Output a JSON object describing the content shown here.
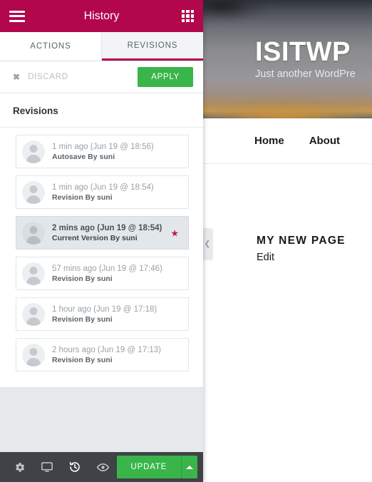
{
  "panel": {
    "title": "History",
    "menu_icon": "hamburger-icon",
    "grid_icon": "grid-apps-icon",
    "tabs": [
      {
        "label": "ACTIONS",
        "active": false
      },
      {
        "label": "REVISIONS",
        "active": true
      }
    ],
    "actions_bar": {
      "discard_label": "DISCARD",
      "discard_icon": "close-x-icon",
      "apply_label": "APPLY",
      "apply_color": "#39b54a"
    },
    "section_title": "Revisions",
    "revisions": [
      {
        "when": "1 min ago (Jun 19 @ 18:56)",
        "who": "Autosave By suni",
        "current": false,
        "starred": false
      },
      {
        "when": "1 min ago (Jun 19 @ 18:54)",
        "who": "Revision By suni",
        "current": false,
        "starred": false
      },
      {
        "when": "2 mins ago (Jun 19 @ 18:54)",
        "who": "Current Version By suni",
        "current": true,
        "starred": true
      },
      {
        "when": "57 mins ago (Jun 19 @ 17:46)",
        "who": "Revision By suni",
        "current": false,
        "starred": false
      },
      {
        "when": "1 hour ago (Jun 19 @ 17:18)",
        "who": "Revision By suni",
        "current": false,
        "starred": false
      },
      {
        "when": "2 hours ago (Jun 19 @ 17:13)",
        "who": "Revision By suni",
        "current": false,
        "starred": false
      }
    ],
    "bottom_bar": {
      "icons": [
        {
          "name": "settings-gear-icon",
          "active": false
        },
        {
          "name": "responsive-monitor-icon",
          "active": false
        },
        {
          "name": "history-revisions-icon",
          "active": true
        },
        {
          "name": "preview-eye-icon",
          "active": false
        }
      ],
      "update_label": "UPDATE",
      "update_caret_icon": "caret-up-icon"
    },
    "accent_color": "#b2074c",
    "star_color": "#c2185b"
  },
  "preview": {
    "site_title": "ISITWP",
    "site_tagline": "Just another WordPre",
    "nav": [
      {
        "label": "Home"
      },
      {
        "label": "About"
      }
    ],
    "page_heading": "MY NEW PAGE",
    "edit_link": "Edit",
    "collapse_handle_icon": "chevron-left-icon"
  }
}
